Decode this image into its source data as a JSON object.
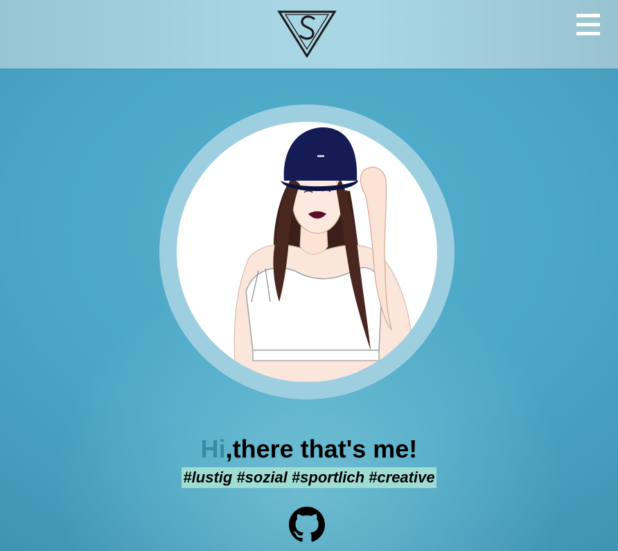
{
  "header": {
    "logo_icon": "vs-monogram-logo",
    "menu_icon": "hamburger-menu-icon"
  },
  "profile": {
    "avatar_icon": "illustrated-portrait"
  },
  "intro": {
    "greeting": "Hi",
    "headline_rest": ",there that's me!",
    "hashtags": "#lustig #sozial #sportlich #creative"
  },
  "links": {
    "github_icon": "github-icon"
  },
  "colors": {
    "background": "#4ba6c6",
    "header": "#a7d4e3",
    "avatar_ring": "#9ecfe0",
    "greeting_accent": "#3a8aa3",
    "hashtag_highlight": "#9fdcd4"
  }
}
